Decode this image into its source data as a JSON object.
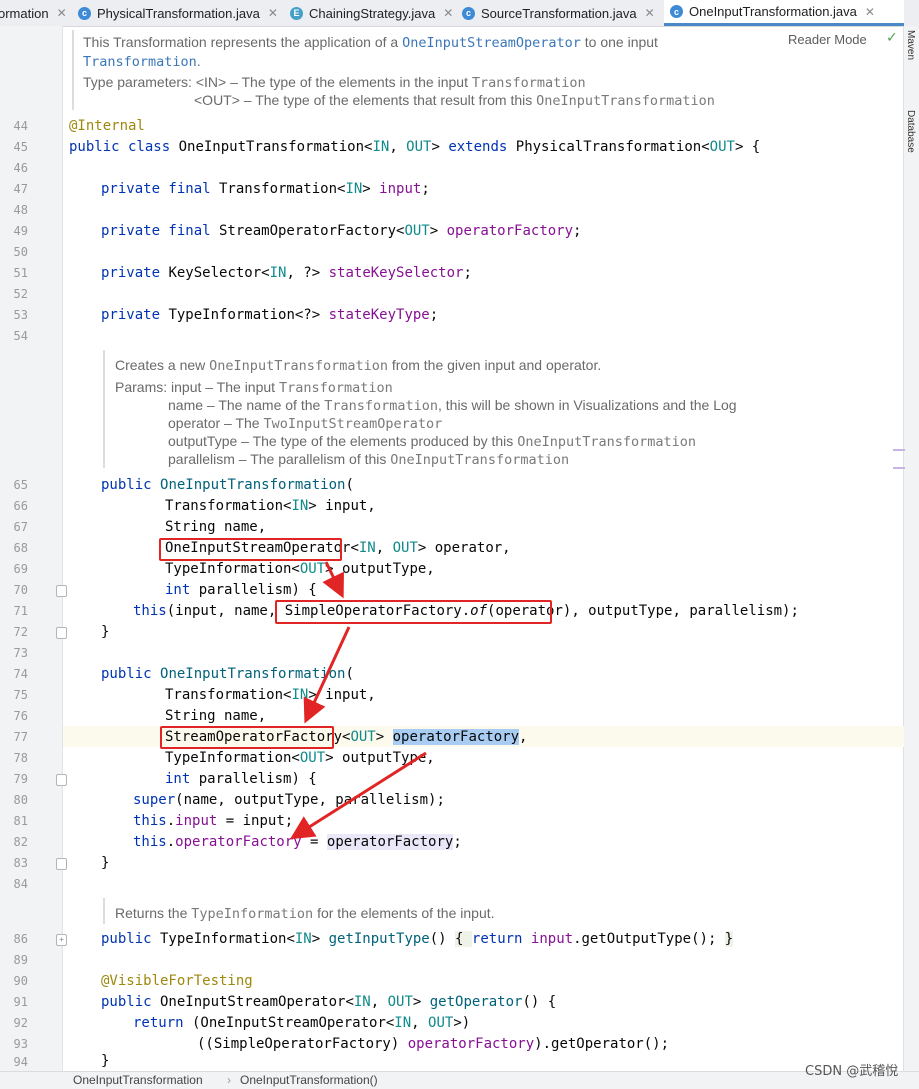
{
  "tabs": [
    {
      "label": "ormation",
      "icon": "class-icon",
      "closable": true
    },
    {
      "label": "PhysicalTransformation.java",
      "icon": "class-icon",
      "closable": true
    },
    {
      "label": "ChainingStrategy.java",
      "icon": "enum-icon",
      "closable": true
    },
    {
      "label": "SourceTransformation.java",
      "icon": "class-icon",
      "closable": true
    },
    {
      "label": "OneInputTransformation.java",
      "icon": "class-icon",
      "closable": true,
      "active": true
    }
  ],
  "reader_mode_label": "Reader Mode",
  "right_tools": [
    "Maven",
    "Database"
  ],
  "class_doc": {
    "line1_pre": "This Transformation represents the application of a ",
    "line1_link": "OneInputStreamOperator",
    "line1_post": " to one input",
    "line2_link": "Transformation",
    "line2_post": ".",
    "type_params_label": "Type parameters:",
    "param_in_pre": "<IN> – The type of the elements in the input ",
    "param_in_mono": "Transformation",
    "param_out_pre": "<OUT> – The type of the elements that result from this ",
    "param_out_mono": "OneInputTransformation"
  },
  "ctor_doc": {
    "line1_pre": "Creates a new ",
    "line1_mono": "OneInputTransformation",
    "line1_post": " from the given input and operator.",
    "params_label": "Params:",
    "p_input_pre": "input – The input ",
    "p_input_mono": "Transformation",
    "p_name_pre": "name – The name of the ",
    "p_name_mono": "Transformation",
    "p_name_post": ", this will be shown in Visualizations and the Log",
    "p_op_pre": "operator – The ",
    "p_op_mono": "TwoInputStreamOperator",
    "p_out_pre": "outputType – The type of the elements produced by this ",
    "p_out_mono": "OneInputTransformation",
    "p_par_pre": "parallelism – The parallelism of this ",
    "p_par_mono": "OneInputTransformation"
  },
  "getter_doc": {
    "pre": "Returns the ",
    "mono": "TypeInformation",
    "post": " for the elements of the input."
  },
  "line_numbers": [
    "44",
    "45",
    "46",
    "47",
    "48",
    "49",
    "50",
    "51",
    "52",
    "53",
    "54",
    "65",
    "66",
    "67",
    "68",
    "69",
    "70",
    "71",
    "72",
    "73",
    "74",
    "75",
    "76",
    "77",
    "78",
    "79",
    "80",
    "81",
    "82",
    "83",
    "84",
    "86",
    "89",
    "90",
    "91",
    "92",
    "93",
    "94"
  ],
  "code": {
    "l44": "@Internal",
    "l45_kw": "public class",
    "l45_cls": " OneInputTransformation<",
    "l45_in": "IN",
    "l45_c1": ", ",
    "l45_out": "OUT",
    "l45_c2": "> ",
    "l45_ext": "extends",
    "l45_super": " PhysicalTransformation<",
    "l45_out2": "OUT",
    "l45_end": "> {",
    "l47_kw": "private final",
    "l47_type": " Transformation<",
    "l47_in": "IN",
    "l47_gt": "> ",
    "l47_field": "input",
    "l47_end": ";",
    "l49_kw": "private final",
    "l49_type": " StreamOperatorFactory<",
    "l49_out": "OUT",
    "l49_gt": "> ",
    "l49_field": "operatorFactory",
    "l49_end": ";",
    "l51_kw": "private",
    "l51_type": " KeySelector<",
    "l51_in": "IN",
    "l51_rest": ", ?> ",
    "l51_field": "stateKeySelector",
    "l51_end": ";",
    "l53_kw": "private",
    "l53_type": " TypeInformation<?> ",
    "l53_field": "stateKeyType",
    "l53_end": ";",
    "l65_kw": "public",
    "l65_name": "OneInputTransformation",
    "l65_end": "(",
    "l66_type": "Transformation<",
    "l66_in": "IN",
    "l66_end": "> input,",
    "l67": "String name,",
    "l68_type": "OneInputStreamOperator",
    "l68_lt": "<",
    "l68_in": "IN",
    "l68_c": ", ",
    "l68_out": "OUT",
    "l68_end": "> operator,",
    "l69_type": "TypeInformation<",
    "l69_out": "OUT",
    "l69_end": "> outputType,",
    "l70_kw": "int",
    "l70_end": " parallelism) {",
    "l71_kw": "this",
    "l71_args": "(input, name, ",
    "l71_fac": "SimpleOperatorFactory.",
    "l71_of": "of",
    "l71_op": "(operator)",
    "l71_end": ", outputType, parallelism);",
    "l72": "}",
    "l74_kw": "public",
    "l74_name": "OneInputTransformation",
    "l74_end": "(",
    "l75_type": "Transformation<",
    "l75_in": "IN",
    "l75_end": "> input,",
    "l76": "String name,",
    "l77_type": "StreamOperatorFactory",
    "l77_lt": "<",
    "l77_out": "OUT",
    "l77_gt": "> ",
    "l77_param": "operatorFactory",
    "l77_end": ",",
    "l78_type": "TypeInformation<",
    "l78_out": "OUT",
    "l78_end": "> outputType,",
    "l79_kw": "int",
    "l79_end": " parallelism) {",
    "l80_kw": "super",
    "l80_end": "(name, outputType, parallelism);",
    "l81_kw": "this",
    "l81_dot": ".",
    "l81_field": "input",
    "l81_end": " = input;",
    "l82_kw": "this",
    "l82_dot": ".",
    "l82_field": "operatorFactory",
    "l82_eq": " = ",
    "l82_val": "operatorFactory",
    "l82_end": ";",
    "l83": "}",
    "l86_kw": "public",
    "l86_type": " TypeInformation<",
    "l86_in": "IN",
    "l86_gt": "> ",
    "l86_name": "getInputType",
    "l86_p": "() ",
    "l86_ob": "{ ",
    "l86_ret": "return",
    "l86_sp": " ",
    "l86_field": "input",
    "l86_call": ".getOutputType(); ",
    "l86_cb": "}",
    "l90": "@VisibleForTesting",
    "l91_kw": "public",
    "l91_type": " OneInputStreamOperator<",
    "l91_in": "IN",
    "l91_c": ", ",
    "l91_out": "OUT",
    "l91_gt": "> ",
    "l91_name": "getOperator",
    "l91_end": "() {",
    "l92_kw": "return",
    "l92_type": " (OneInputStreamOperator<",
    "l92_in": "IN",
    "l92_c": ", ",
    "l92_out": "OUT",
    "l92_end": ">)",
    "l93_pre": "((SimpleOperatorFactory) ",
    "l93_field": "operatorFactory",
    "l93_end": ").getOperator();",
    "l94": "}"
  },
  "breadcrumb": [
    "OneInputTransformation",
    "OneInputTransformation()"
  ],
  "watermark": "CSDN @武稽悅",
  "colors": {
    "annotation_red": "#e12525",
    "keyword": "#0033b3",
    "field": "#871094",
    "type_param": "#0f8a8a",
    "method": "#00627a"
  }
}
